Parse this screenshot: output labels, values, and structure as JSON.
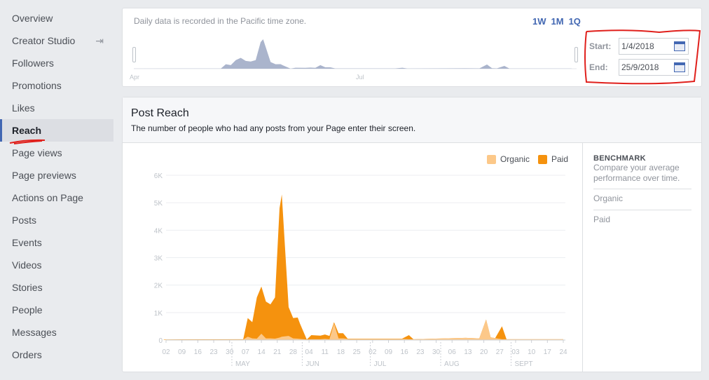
{
  "sidebar": {
    "items": [
      {
        "label": "Overview"
      },
      {
        "label": "Creator Studio",
        "icon": "external-enter-icon"
      },
      {
        "label": "Followers"
      },
      {
        "label": "Promotions"
      },
      {
        "label": "Likes"
      },
      {
        "label": "Reach",
        "active": true
      },
      {
        "label": "Page views"
      },
      {
        "label": "Page previews"
      },
      {
        "label": "Actions on Page"
      },
      {
        "label": "Posts"
      },
      {
        "label": "Events"
      },
      {
        "label": "Videos"
      },
      {
        "label": "Stories"
      },
      {
        "label": "People"
      },
      {
        "label": "Messages"
      },
      {
        "label": "Orders"
      }
    ]
  },
  "range": {
    "note": "Daily data is recorded in the Pacific time zone.",
    "presets": [
      "1W",
      "1M",
      "1Q"
    ],
    "start_label": "Start:",
    "start_value": "1/4/2018",
    "end_label": "End:",
    "end_value": "25/9/2018",
    "overview_labels": [
      "Apr",
      "Jul"
    ],
    "overview_color": "#aab4cc"
  },
  "post_reach": {
    "title": "Post Reach",
    "subtitle": "The number of people who had any posts from your Page enter their screen.",
    "benchmark": {
      "title": "BENCHMARK",
      "subtitle": "Compare your average performance over time.",
      "items": [
        "Organic",
        "Paid"
      ]
    }
  },
  "chart_data": {
    "type": "area",
    "stacked": true,
    "year": 2018,
    "legend_position": "top-right",
    "grid": true,
    "series": [
      {
        "name": "Organic",
        "color": "#fcc889"
      },
      {
        "name": "Paid",
        "color": "#f5920e"
      }
    ],
    "ylim": [
      0,
      6000
    ],
    "y_ticks": [
      "0",
      "1K",
      "2K",
      "3K",
      "4K",
      "5K",
      "6K"
    ],
    "x_ticks": [
      "02",
      "09",
      "16",
      "23",
      "30",
      "07",
      "14",
      "21",
      "28",
      "04",
      "11",
      "18",
      "25",
      "02",
      "09",
      "16",
      "23",
      "30",
      "06",
      "13",
      "20",
      "27",
      "03",
      "10",
      "17",
      "24"
    ],
    "months": [
      "MAY",
      "JUN",
      "JUL",
      "AUG",
      "SEPT"
    ],
    "points": [
      [
        "2018-04-01",
        10,
        10
      ],
      [
        "2018-04-20",
        15,
        10
      ],
      [
        "2018-05-06",
        20,
        10
      ],
      [
        "2018-05-08",
        120,
        680
      ],
      [
        "2018-05-10",
        60,
        590
      ],
      [
        "2018-05-12",
        50,
        1500
      ],
      [
        "2018-05-14",
        230,
        1720
      ],
      [
        "2018-05-16",
        60,
        1340
      ],
      [
        "2018-05-18",
        60,
        1240
      ],
      [
        "2018-05-20",
        50,
        1500
      ],
      [
        "2018-05-22",
        90,
        4710
      ],
      [
        "2018-05-23",
        120,
        5180
      ],
      [
        "2018-05-26",
        150,
        1050
      ],
      [
        "2018-05-28",
        60,
        740
      ],
      [
        "2018-05-30",
        50,
        770
      ],
      [
        "2018-05-31",
        40,
        560
      ],
      [
        "2018-06-03",
        20,
        0
      ],
      [
        "2018-06-05",
        30,
        150
      ],
      [
        "2018-06-09",
        30,
        130
      ],
      [
        "2018-06-11",
        40,
        160
      ],
      [
        "2018-06-13",
        30,
        120
      ],
      [
        "2018-06-15",
        600,
        50
      ],
      [
        "2018-06-17",
        60,
        190
      ],
      [
        "2018-06-19",
        60,
        190
      ],
      [
        "2018-06-21",
        40,
        10
      ],
      [
        "2018-07-15",
        40,
        10
      ],
      [
        "2018-07-18",
        30,
        150
      ],
      [
        "2018-07-20",
        30,
        0
      ],
      [
        "2018-08-12",
        80,
        0
      ],
      [
        "2018-08-18",
        60,
        0
      ],
      [
        "2018-08-21",
        750,
        0
      ],
      [
        "2018-08-23",
        100,
        0
      ],
      [
        "2018-08-25",
        70,
        0
      ],
      [
        "2018-08-28",
        30,
        470
      ],
      [
        "2018-08-30",
        30,
        0
      ],
      [
        "2018-09-24",
        30,
        0
      ]
    ]
  }
}
